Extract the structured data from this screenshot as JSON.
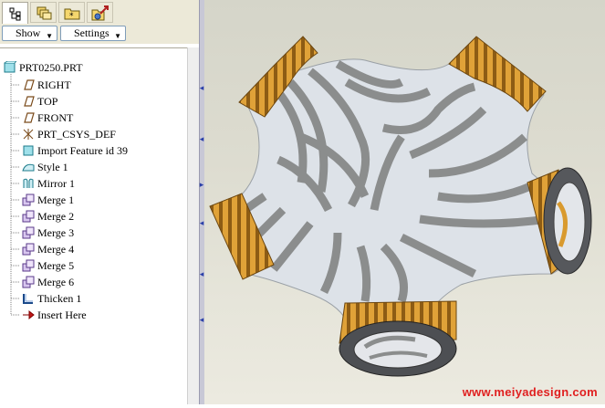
{
  "panel": {
    "tabs": [
      {
        "name": "model-tree",
        "icon": "model-tree-icon",
        "active": true
      },
      {
        "name": "folder-browser",
        "icon": "folder-browser-icon",
        "active": false
      },
      {
        "name": "favorites",
        "icon": "favorites-icon",
        "active": false
      },
      {
        "name": "connections",
        "icon": "connections-icon",
        "active": false
      }
    ],
    "show_label": "Show",
    "settings_label": "Settings"
  },
  "tree": {
    "root": "PRT0250.PRT",
    "items": [
      {
        "label": "RIGHT",
        "icon": "datum-plane-icon"
      },
      {
        "label": "TOP",
        "icon": "datum-plane-icon"
      },
      {
        "label": "FRONT",
        "icon": "datum-plane-icon"
      },
      {
        "label": "PRT_CSYS_DEF",
        "icon": "coordinate-system-icon"
      },
      {
        "label": "Import Feature id 39",
        "icon": "import-feature-icon"
      },
      {
        "label": "Style 1",
        "icon": "style-icon"
      },
      {
        "label": "Mirror 1",
        "icon": "mirror-icon"
      },
      {
        "label": "Merge 1",
        "icon": "merge-icon"
      },
      {
        "label": "Merge 2",
        "icon": "merge-icon"
      },
      {
        "label": "Merge 3",
        "icon": "merge-icon"
      },
      {
        "label": "Merge 4",
        "icon": "merge-icon"
      },
      {
        "label": "Merge 5",
        "icon": "merge-icon"
      },
      {
        "label": "Merge 6",
        "icon": "merge-icon"
      },
      {
        "label": "Thicken 1",
        "icon": "thicken-icon"
      },
      {
        "label": "Insert Here",
        "icon": "insert-arrow-icon"
      }
    ]
  },
  "graphics": {
    "watermark": "www.meiyadesign.com",
    "colors": {
      "surface": "#dfe3e8",
      "stripe": "#8a8c8c",
      "band_gold": "#d99a2e",
      "band_dark": "#8a5a12",
      "watermark": "#e02020"
    }
  }
}
